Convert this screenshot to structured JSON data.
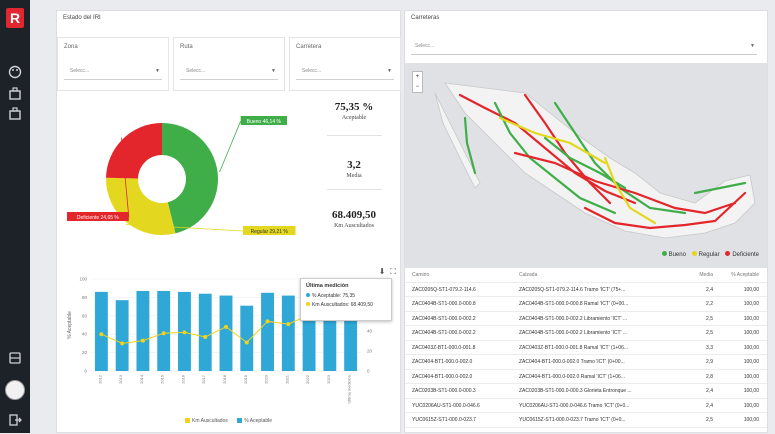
{
  "app": {
    "logo_letter": "R"
  },
  "left": {
    "title": "Estado del IRI",
    "filters": [
      {
        "label": "Zona",
        "placeholder": "Selecc..."
      },
      {
        "label": "Ruta",
        "placeholder": "Selecc..."
      },
      {
        "label": "Carretera",
        "placeholder": "Selecc..."
      }
    ],
    "kpis": [
      {
        "value": "75,35 %",
        "label": "Aceptable"
      },
      {
        "value": "3,2",
        "label": "Media"
      },
      {
        "value": "68.409,50",
        "label": "Km Auscultados"
      }
    ]
  },
  "donut": {
    "slices": [
      {
        "label": "Bueno 46,14 %",
        "value": 46.14,
        "color": "#3fae49"
      },
      {
        "label": "Regular 29,21 %",
        "value": 29.21,
        "color": "#e3d81f"
      },
      {
        "label": "Deficiente 24,65 %",
        "value": 24.65,
        "color": "#e3262b"
      }
    ]
  },
  "chart_data": {
    "type": "bar",
    "categories": [
      "2012",
      "2013",
      "2014",
      "2015",
      "2016",
      "2017",
      "2018",
      "2019",
      "2020",
      "2021",
      "2022",
      "2023",
      "Ultima medición"
    ],
    "series": [
      {
        "name": "% Aceptable",
        "type": "bar",
        "color": "#2fa8d8",
        "values": [
          86,
          77,
          87,
          87,
          86,
          84,
          82,
          71,
          85,
          82,
          80,
          78,
          75.35
        ]
      },
      {
        "name": "Km Auscultados",
        "type": "line",
        "color": "#f2d21a",
        "values": [
          40,
          30,
          33,
          41,
          42,
          37,
          48,
          31,
          54,
          51,
          61,
          57,
          68.409
        ]
      }
    ],
    "ylabel": "% Aceptable",
    "ylim": [
      0,
      100
    ],
    "yticks": [
      "100",
      "80",
      "60",
      "40",
      "20",
      "0"
    ],
    "y2ticks": [
      "80",
      "60",
      "40",
      "20",
      "0"
    ]
  },
  "tooltip": {
    "title": "Última medición",
    "line1": "% Aceptable: 75,35",
    "line2": "Km Auscultados: 68.409,50"
  },
  "right": {
    "title": "Carreteras",
    "select_placeholder": "Selecc...",
    "map_legend": [
      "Bueno",
      "Regular",
      "Deficiente"
    ],
    "table": {
      "headers": [
        "Camino",
        "Calzada",
        "Media",
        "% Aceptable"
      ],
      "rows": [
        [
          "ZAC0205Q-ST1-079.2-114.6",
          "ZAC0205Q-ST1-079.2-114.6 Tramo 'ICT' (75+...",
          "2,4",
          "100,00"
        ],
        [
          "ZAC0404B-ST1-000.0-000.8",
          "ZAC0404B-ST1-000.0-000.8 Ramal 'ICT' (0+00...",
          "2,2",
          "100,00"
        ],
        [
          "ZAC0404B-ST1-000.0-002.2",
          "ZAC0404B-ST1-000.0-002.2 Libramiento 'ICT' ...",
          "2,5",
          "100,00"
        ],
        [
          "ZAC0404B-ST1-000.0-002.2",
          "ZAC0404B-ST1-000.0-002.2 Libramiento 'ICT' ...",
          "2,5",
          "100,00"
        ],
        [
          "ZAC0403Z-BT1-000.0-001.8",
          "ZAC0403Z-BT1-000.0-001.8 Ramal 'ICT' (1+06...",
          "3,3",
          "100,00"
        ],
        [
          "ZAC0404-BT1-000.0-002.0",
          "ZAC0404-BT1-000.0-002.0 Tramo 'ICT' (0+00...",
          "2,9",
          "100,00"
        ],
        [
          "ZAC0404-BT1-000.0-002.0",
          "ZAC0404-BT1-000.0-002.0 Ramal 'ICT' (1+06...",
          "2,8",
          "100,00"
        ],
        [
          "ZAC0203B-ST1-000.0-000.3",
          "ZAC0203B-ST1-000.0-000.3 Glorieta Entronque ...",
          "2,4",
          "100,00"
        ],
        [
          "YUC0206AU-ST1-000.0-046.6",
          "YUC0206AU-ST1-000.0-046.6 Tramo 'ICT' (0+0...",
          "2,4",
          "100,00"
        ],
        [
          "YUC0615Z-ST1-000.0-023.7",
          "YUC0615Z-ST1-000.0-023.7 Tramo 'ICT' (0+0...",
          "2,5",
          "100,00"
        ]
      ]
    }
  },
  "colors": {
    "accent": "#e0262f",
    "sidebar": "#1d2128",
    "bar": "#2fa8d8",
    "line": "#f2d21a"
  }
}
